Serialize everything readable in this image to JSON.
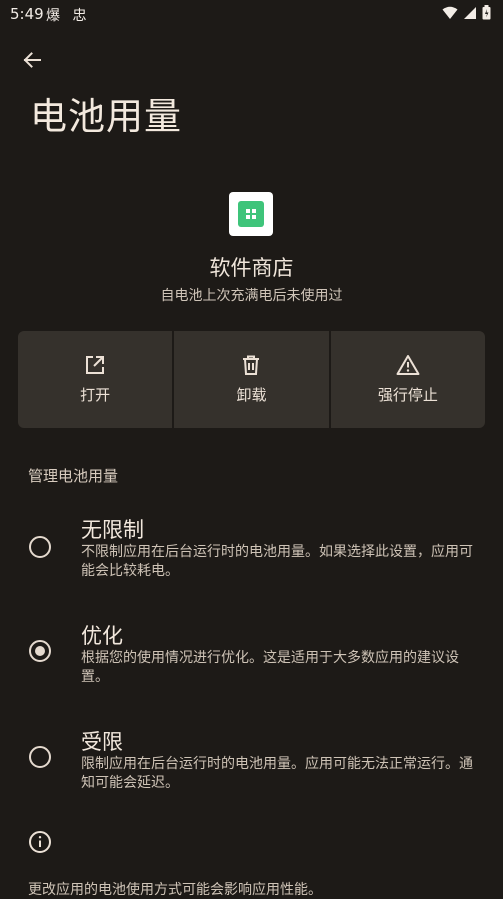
{
  "status_bar": {
    "time": "5:49",
    "left_icons": "爆 忠"
  },
  "header": {
    "title": "电池用量"
  },
  "app": {
    "name": "软件商店",
    "usage": "自电池上次充满电后未使用过"
  },
  "actions": {
    "open": "打开",
    "uninstall": "卸载",
    "force_stop": "强行停止"
  },
  "section": {
    "title": "管理电池用量"
  },
  "options": [
    {
      "title": "无限制",
      "desc": "不限制应用在后台运行时的电池用量。如果选择此设置，应用可能会比较耗电。",
      "selected": false
    },
    {
      "title": "优化",
      "desc": "根据您的使用情况进行优化。这是适用于大多数应用的建议设置。",
      "selected": true
    },
    {
      "title": "受限",
      "desc": "限制应用在后台运行时的电池用量。应用可能无法正常运行。通知可能会延迟。",
      "selected": false
    }
  ],
  "footer": {
    "text": "更改应用的电池使用方式可能会影响应用性能。"
  },
  "colors": {
    "background": "#1d1a17",
    "button_bg": "#35312c",
    "app_icon_green": "#3ec47a"
  }
}
